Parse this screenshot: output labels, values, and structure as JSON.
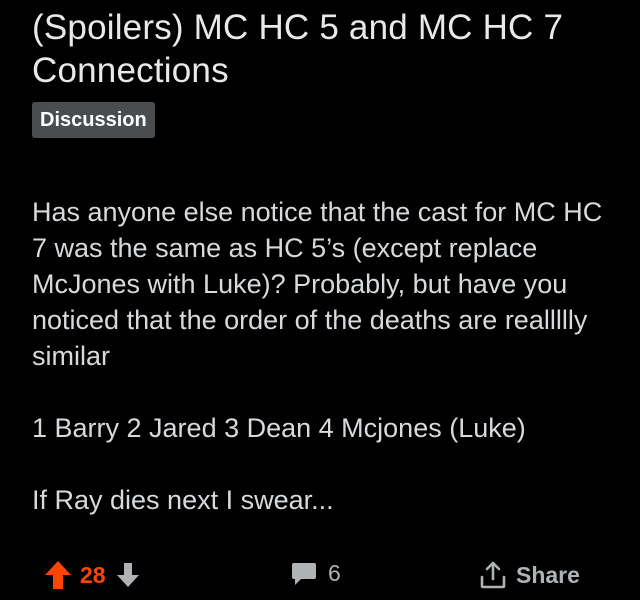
{
  "post": {
    "title": "(Spoilers) MC HC 5 and MC HC 7 Connections",
    "flair": "Discussion",
    "body_paragraphs": [
      "Has anyone else notice that the cast for MC HC 7 was the same as HC 5’s (except replace McJones with Luke)? Probably, but have you noticed that the order of the deaths are reallllly similar",
      "1 Barry 2 Jared 3 Dean 4 Mcjones (Luke)",
      "If Ray dies next I swear..."
    ]
  },
  "actions": {
    "score": "28",
    "comment_count": "6",
    "share_label": "Share",
    "upvote_icon": "arrow-up-icon",
    "downvote_icon": "arrow-down-icon",
    "comment_icon": "speech-bubble-icon",
    "share_icon": "share-arrow-icon"
  },
  "colors": {
    "background": "#000000",
    "text": "#d7dadc",
    "flair_background": "#4a4d50",
    "upvoted_accent": "#ff4500",
    "action_gray": "#b0b3b6"
  }
}
